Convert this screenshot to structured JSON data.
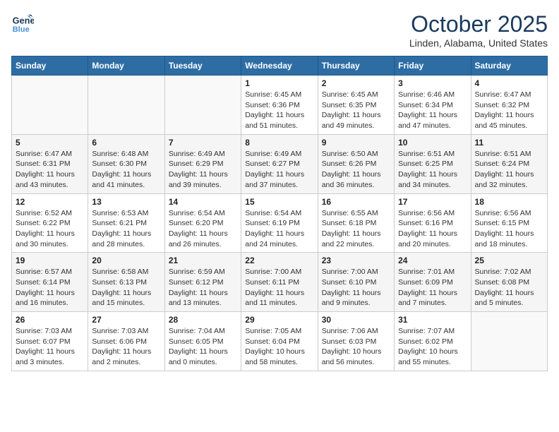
{
  "header": {
    "logo_line1": "General",
    "logo_line2": "Blue",
    "month": "October 2025",
    "location": "Linden, Alabama, United States"
  },
  "weekdays": [
    "Sunday",
    "Monday",
    "Tuesday",
    "Wednesday",
    "Thursday",
    "Friday",
    "Saturday"
  ],
  "weeks": [
    [
      {
        "day": "",
        "info": ""
      },
      {
        "day": "",
        "info": ""
      },
      {
        "day": "",
        "info": ""
      },
      {
        "day": "1",
        "info": "Sunrise: 6:45 AM\nSunset: 6:36 PM\nDaylight: 11 hours\nand 51 minutes."
      },
      {
        "day": "2",
        "info": "Sunrise: 6:45 AM\nSunset: 6:35 PM\nDaylight: 11 hours\nand 49 minutes."
      },
      {
        "day": "3",
        "info": "Sunrise: 6:46 AM\nSunset: 6:34 PM\nDaylight: 11 hours\nand 47 minutes."
      },
      {
        "day": "4",
        "info": "Sunrise: 6:47 AM\nSunset: 6:32 PM\nDaylight: 11 hours\nand 45 minutes."
      }
    ],
    [
      {
        "day": "5",
        "info": "Sunrise: 6:47 AM\nSunset: 6:31 PM\nDaylight: 11 hours\nand 43 minutes."
      },
      {
        "day": "6",
        "info": "Sunrise: 6:48 AM\nSunset: 6:30 PM\nDaylight: 11 hours\nand 41 minutes."
      },
      {
        "day": "7",
        "info": "Sunrise: 6:49 AM\nSunset: 6:29 PM\nDaylight: 11 hours\nand 39 minutes."
      },
      {
        "day": "8",
        "info": "Sunrise: 6:49 AM\nSunset: 6:27 PM\nDaylight: 11 hours\nand 37 minutes."
      },
      {
        "day": "9",
        "info": "Sunrise: 6:50 AM\nSunset: 6:26 PM\nDaylight: 11 hours\nand 36 minutes."
      },
      {
        "day": "10",
        "info": "Sunrise: 6:51 AM\nSunset: 6:25 PM\nDaylight: 11 hours\nand 34 minutes."
      },
      {
        "day": "11",
        "info": "Sunrise: 6:51 AM\nSunset: 6:24 PM\nDaylight: 11 hours\nand 32 minutes."
      }
    ],
    [
      {
        "day": "12",
        "info": "Sunrise: 6:52 AM\nSunset: 6:22 PM\nDaylight: 11 hours\nand 30 minutes."
      },
      {
        "day": "13",
        "info": "Sunrise: 6:53 AM\nSunset: 6:21 PM\nDaylight: 11 hours\nand 28 minutes."
      },
      {
        "day": "14",
        "info": "Sunrise: 6:54 AM\nSunset: 6:20 PM\nDaylight: 11 hours\nand 26 minutes."
      },
      {
        "day": "15",
        "info": "Sunrise: 6:54 AM\nSunset: 6:19 PM\nDaylight: 11 hours\nand 24 minutes."
      },
      {
        "day": "16",
        "info": "Sunrise: 6:55 AM\nSunset: 6:18 PM\nDaylight: 11 hours\nand 22 minutes."
      },
      {
        "day": "17",
        "info": "Sunrise: 6:56 AM\nSunset: 6:16 PM\nDaylight: 11 hours\nand 20 minutes."
      },
      {
        "day": "18",
        "info": "Sunrise: 6:56 AM\nSunset: 6:15 PM\nDaylight: 11 hours\nand 18 minutes."
      }
    ],
    [
      {
        "day": "19",
        "info": "Sunrise: 6:57 AM\nSunset: 6:14 PM\nDaylight: 11 hours\nand 16 minutes."
      },
      {
        "day": "20",
        "info": "Sunrise: 6:58 AM\nSunset: 6:13 PM\nDaylight: 11 hours\nand 15 minutes."
      },
      {
        "day": "21",
        "info": "Sunrise: 6:59 AM\nSunset: 6:12 PM\nDaylight: 11 hours\nand 13 minutes."
      },
      {
        "day": "22",
        "info": "Sunrise: 7:00 AM\nSunset: 6:11 PM\nDaylight: 11 hours\nand 11 minutes."
      },
      {
        "day": "23",
        "info": "Sunrise: 7:00 AM\nSunset: 6:10 PM\nDaylight: 11 hours\nand 9 minutes."
      },
      {
        "day": "24",
        "info": "Sunrise: 7:01 AM\nSunset: 6:09 PM\nDaylight: 11 hours\nand 7 minutes."
      },
      {
        "day": "25",
        "info": "Sunrise: 7:02 AM\nSunset: 6:08 PM\nDaylight: 11 hours\nand 5 minutes."
      }
    ],
    [
      {
        "day": "26",
        "info": "Sunrise: 7:03 AM\nSunset: 6:07 PM\nDaylight: 11 hours\nand 3 minutes."
      },
      {
        "day": "27",
        "info": "Sunrise: 7:03 AM\nSunset: 6:06 PM\nDaylight: 11 hours\nand 2 minutes."
      },
      {
        "day": "28",
        "info": "Sunrise: 7:04 AM\nSunset: 6:05 PM\nDaylight: 11 hours\nand 0 minutes."
      },
      {
        "day": "29",
        "info": "Sunrise: 7:05 AM\nSunset: 6:04 PM\nDaylight: 10 hours\nand 58 minutes."
      },
      {
        "day": "30",
        "info": "Sunrise: 7:06 AM\nSunset: 6:03 PM\nDaylight: 10 hours\nand 56 minutes."
      },
      {
        "day": "31",
        "info": "Sunrise: 7:07 AM\nSunset: 6:02 PM\nDaylight: 10 hours\nand 55 minutes."
      },
      {
        "day": "",
        "info": ""
      }
    ]
  ]
}
